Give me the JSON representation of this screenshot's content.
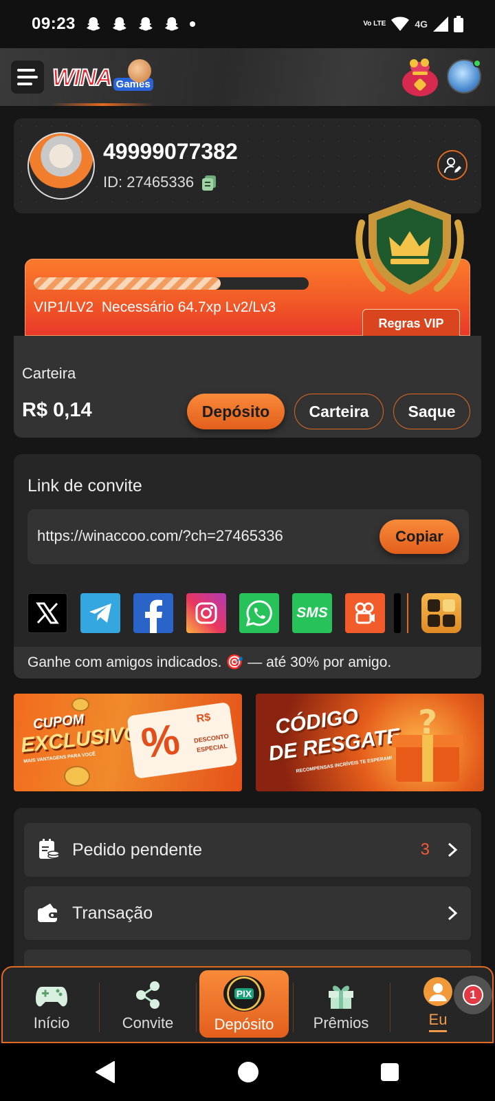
{
  "status_bar": {
    "time": "09:23",
    "volte": "Vo LTE",
    "network": "4G",
    "icons": [
      "snapchat-icon",
      "snapchat-icon",
      "snapchat-icon",
      "snapchat-icon",
      "dot-icon",
      "volte-icon",
      "wifi-icon",
      "signal-icon",
      "battery-icon"
    ]
  },
  "header": {
    "logo_text": "WINA",
    "logo_sub": "Games",
    "icons": [
      "menu-icon",
      "treasure-bag-icon",
      "user-avatar-icon"
    ]
  },
  "profile": {
    "phone": "49999077382",
    "id_label": "ID: 27465336"
  },
  "vip": {
    "progress": 0.68,
    "current_level": "VIP1/LV2",
    "requirement": "Necessário 64.7xp Lv2/Lv3",
    "rules_button": "Regras VIP"
  },
  "wallet": {
    "label": "Carteira",
    "balance": "R$ 0,14",
    "deposit_button": "Depósito",
    "wallet_button": "Carteira",
    "withdraw_button": "Saque"
  },
  "invite": {
    "title": "Link de convite",
    "url": "https://winaccoo.com/?ch=27465336",
    "copy_button": "Copiar",
    "share_icons": [
      "x-icon",
      "telegram-icon",
      "facebook-icon",
      "instagram-icon",
      "whatsapp-icon",
      "sms-icon",
      "kwai-icon"
    ],
    "sms_label": "SMS",
    "tip": "Ganhe com amigos indicados. 🎯 — até 30% por amigo."
  },
  "promos": {
    "left": {
      "line1": "CUPOM",
      "line2": "EXCLUSIVO",
      "sub": "MAIS VANTAGENS PARA VOCÊ",
      "ticket_currency": "R$",
      "ticket_text1": "DESCONTO",
      "ticket_text2": "ESPECIAL"
    },
    "right": {
      "line1": "CÓDIGO",
      "line2": "DE RESGATE",
      "sub": "RECOMPENSAS INCRÍVEIS TE ESPERAM!"
    }
  },
  "menu": {
    "items": [
      {
        "label": "Pedido pendente",
        "count": "3"
      },
      {
        "label": "Transação"
      }
    ]
  },
  "bottom_nav": {
    "items": [
      {
        "label": "Início"
      },
      {
        "label": "Convite"
      },
      {
        "label": "Depósito"
      },
      {
        "label": "Prêmios"
      },
      {
        "label": "Eu"
      }
    ],
    "pix_text": "PIX",
    "notification_count": "1"
  },
  "colors": {
    "accent": "#e25f1c",
    "background": "#161616",
    "card": "#262626",
    "badge": "#e23a45"
  }
}
